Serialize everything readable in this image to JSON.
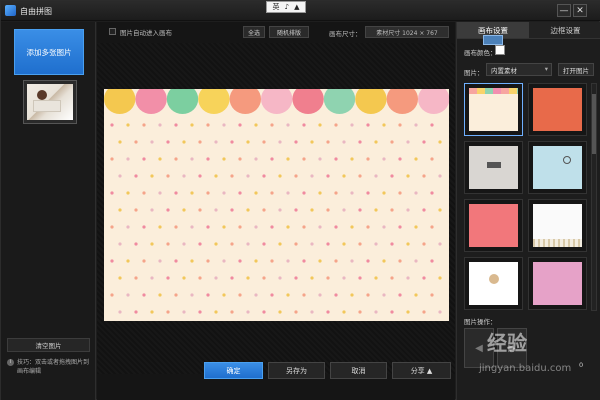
{
  "window": {
    "title": "自由拼图",
    "ime": [
      "英",
      "♪",
      "▲"
    ],
    "minimize": "—",
    "close": "✕"
  },
  "left": {
    "add_button": "添加多张图片",
    "clear_button": "清空图片",
    "tip_text": "技巧：双击或者拖拽图片到画布编辑"
  },
  "toolbar": {
    "auto_label": "图片自动进入画布",
    "select_all": "全选",
    "shuffle": "随机排版",
    "size_label": "画布尺寸：",
    "size_value": "素材尺寸 1024 × 767"
  },
  "bottom": {
    "ok": "确定",
    "save_as": "另存为",
    "cancel": "取消",
    "share": "分享 ▲"
  },
  "right": {
    "tabs": [
      "画布设置",
      "边框设置"
    ],
    "color_label": "画布颜色：",
    "image_label": "图片：",
    "image_select": "内置素材",
    "open_image": "打开图片",
    "ops_label": "图片操作：",
    "slider_value": "0",
    "watermark": "经验",
    "watermark_url": "jingyan.baidu.com"
  },
  "colors": {
    "accent": "#2f80d8",
    "canvas_bg": "#fbeedb"
  }
}
